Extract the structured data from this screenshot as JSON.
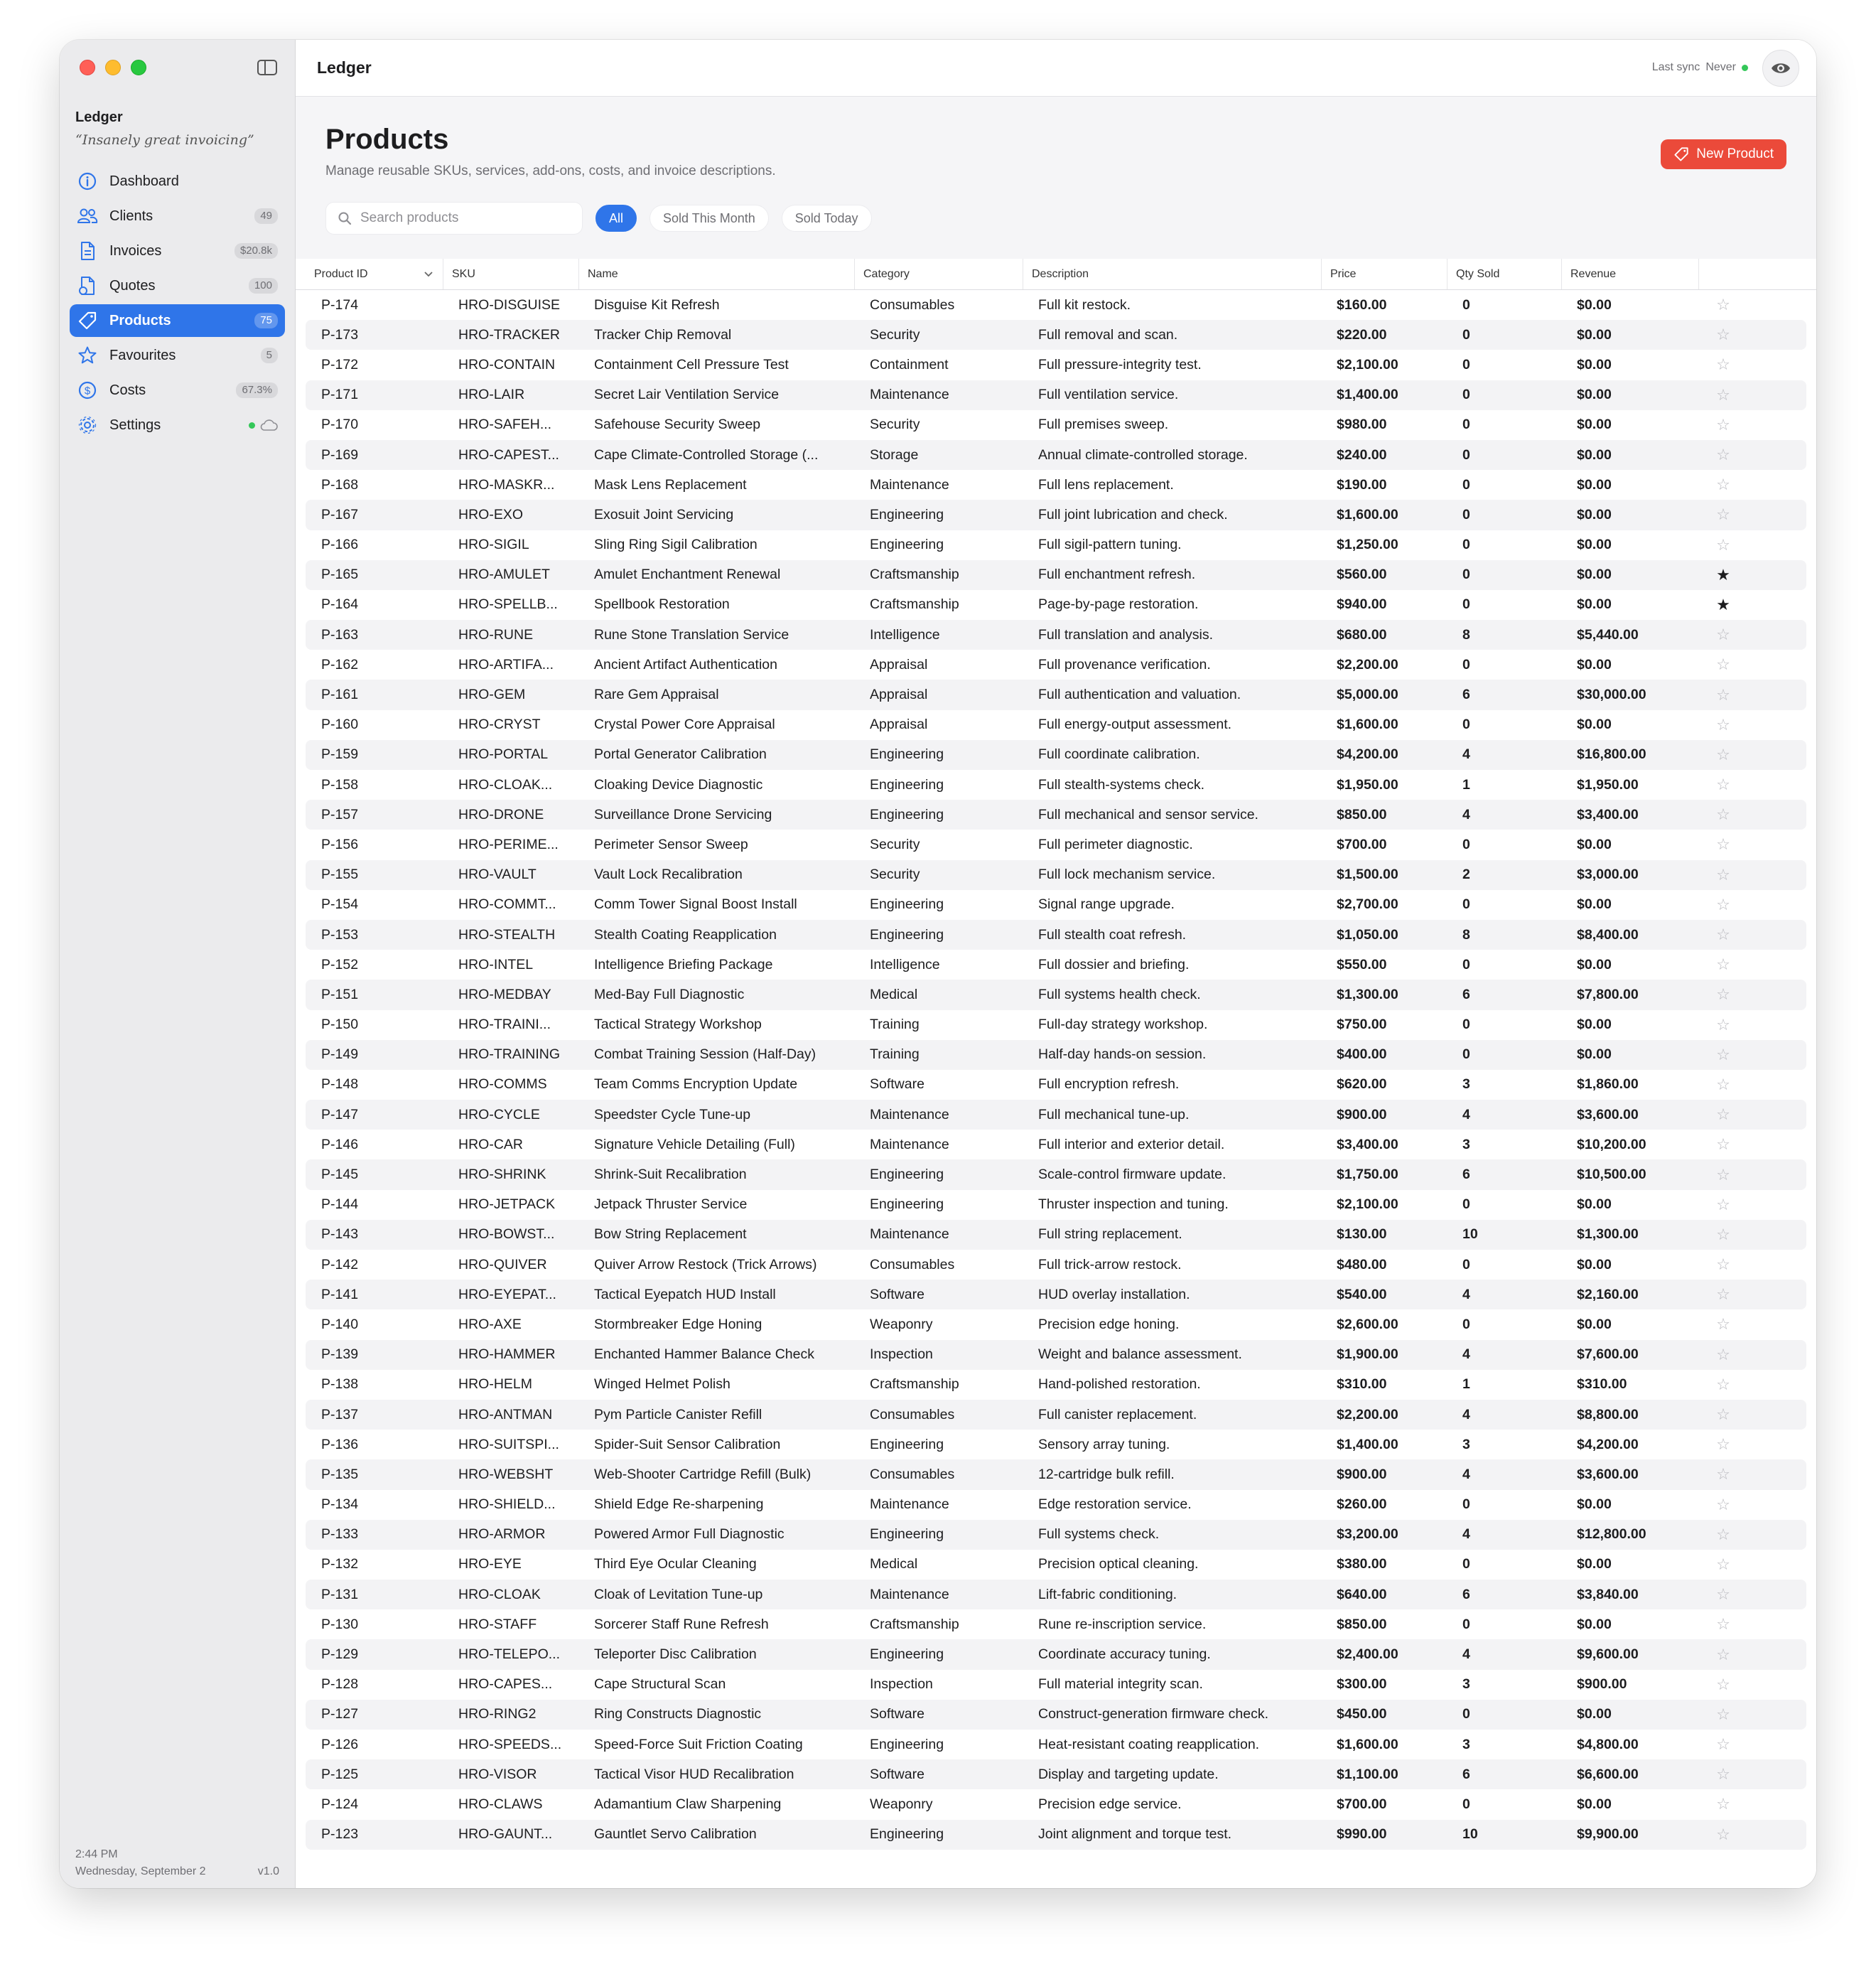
{
  "app": {
    "name": "Ledger",
    "tagline": "“Insanely great invoicing”",
    "footer_time": "2:44 PM",
    "footer_date": "Wednesday, September 2",
    "version": "v1.0",
    "accent": "#2f75e9"
  },
  "sidebar": {
    "items": [
      {
        "label": "Dashboard",
        "badge": "",
        "icon": "info-circle-icon"
      },
      {
        "label": "Clients",
        "badge": "49",
        "icon": "people-icon"
      },
      {
        "label": "Invoices",
        "badge": "$20.8k",
        "icon": "document-icon"
      },
      {
        "label": "Quotes",
        "badge": "100",
        "icon": "quote-document-icon"
      },
      {
        "label": "Products",
        "badge": "75",
        "icon": "tag-icon"
      },
      {
        "label": "Favourites",
        "badge": "5",
        "icon": "star-icon"
      },
      {
        "label": "Costs",
        "badge": "67.3%",
        "icon": "dollar-circle-icon"
      },
      {
        "label": "Settings",
        "badge": "",
        "icon": "gear-icon"
      }
    ]
  },
  "topbar": {
    "title": "Ledger",
    "sync_label": "Last sync",
    "sync_value": "Never"
  },
  "page": {
    "title": "Products",
    "subtitle": "Manage reusable SKUs, services, add-ons, costs, and invoice descriptions.",
    "new_button": "New Product",
    "new_button_color": "#eb4a3a",
    "search_placeholder": "Search products",
    "filters": [
      "All",
      "Sold This Month",
      "Sold Today"
    ]
  },
  "table": {
    "columns": [
      "Product ID",
      "SKU",
      "Name",
      "Category",
      "Description",
      "Price",
      "Qty Sold",
      "Revenue"
    ],
    "rows": [
      [
        "P-174",
        "HRO-DISGUISE",
        "Disguise Kit Refresh",
        "Consumables",
        "Full kit restock.",
        "$160.00",
        "0",
        "$0.00",
        false
      ],
      [
        "P-173",
        "HRO-TRACKER",
        "Tracker Chip Removal",
        "Security",
        "Full removal and scan.",
        "$220.00",
        "0",
        "$0.00",
        false
      ],
      [
        "P-172",
        "HRO-CONTAIN",
        "Containment Cell Pressure Test",
        "Containment",
        "Full pressure-integrity test.",
        "$2,100.00",
        "0",
        "$0.00",
        false
      ],
      [
        "P-171",
        "HRO-LAIR",
        "Secret Lair Ventilation Service",
        "Maintenance",
        "Full ventilation service.",
        "$1,400.00",
        "0",
        "$0.00",
        false
      ],
      [
        "P-170",
        "HRO-SAFEH...",
        "Safehouse Security Sweep",
        "Security",
        "Full premises sweep.",
        "$980.00",
        "0",
        "$0.00",
        false
      ],
      [
        "P-169",
        "HRO-CAPEST...",
        "Cape Climate-Controlled Storage (...",
        "Storage",
        "Annual climate-controlled storage.",
        "$240.00",
        "0",
        "$0.00",
        false
      ],
      [
        "P-168",
        "HRO-MASKR...",
        "Mask Lens Replacement",
        "Maintenance",
        "Full lens replacement.",
        "$190.00",
        "0",
        "$0.00",
        false
      ],
      [
        "P-167",
        "HRO-EXO",
        "Exosuit Joint Servicing",
        "Engineering",
        "Full joint lubrication and check.",
        "$1,600.00",
        "0",
        "$0.00",
        false
      ],
      [
        "P-166",
        "HRO-SIGIL",
        "Sling Ring Sigil Calibration",
        "Engineering",
        "Full sigil-pattern tuning.",
        "$1,250.00",
        "0",
        "$0.00",
        false
      ],
      [
        "P-165",
        "HRO-AMULET",
        "Amulet Enchantment Renewal",
        "Craftsmanship",
        "Full enchantment refresh.",
        "$560.00",
        "0",
        "$0.00",
        true
      ],
      [
        "P-164",
        "HRO-SPELLB...",
        "Spellbook Restoration",
        "Craftsmanship",
        "Page-by-page restoration.",
        "$940.00",
        "0",
        "$0.00",
        true
      ],
      [
        "P-163",
        "HRO-RUNE",
        "Rune Stone Translation Service",
        "Intelligence",
        "Full translation and analysis.",
        "$680.00",
        "8",
        "$5,440.00",
        false
      ],
      [
        "P-162",
        "HRO-ARTIFA...",
        "Ancient Artifact Authentication",
        "Appraisal",
        "Full provenance verification.",
        "$2,200.00",
        "0",
        "$0.00",
        false
      ],
      [
        "P-161",
        "HRO-GEM",
        "Rare Gem Appraisal",
        "Appraisal",
        "Full authentication and valuation.",
        "$5,000.00",
        "6",
        "$30,000.00",
        false
      ],
      [
        "P-160",
        "HRO-CRYST",
        "Crystal Power Core Appraisal",
        "Appraisal",
        "Full energy-output assessment.",
        "$1,600.00",
        "0",
        "$0.00",
        false
      ],
      [
        "P-159",
        "HRO-PORTAL",
        "Portal Generator Calibration",
        "Engineering",
        "Full coordinate calibration.",
        "$4,200.00",
        "4",
        "$16,800.00",
        false
      ],
      [
        "P-158",
        "HRO-CLOAK...",
        "Cloaking Device Diagnostic",
        "Engineering",
        "Full stealth-systems check.",
        "$1,950.00",
        "1",
        "$1,950.00",
        false
      ],
      [
        "P-157",
        "HRO-DRONE",
        "Surveillance Drone Servicing",
        "Engineering",
        "Full mechanical and sensor service.",
        "$850.00",
        "4",
        "$3,400.00",
        false
      ],
      [
        "P-156",
        "HRO-PERIME...",
        "Perimeter Sensor Sweep",
        "Security",
        "Full perimeter diagnostic.",
        "$700.00",
        "0",
        "$0.00",
        false
      ],
      [
        "P-155",
        "HRO-VAULT",
        "Vault Lock Recalibration",
        "Security",
        "Full lock mechanism service.",
        "$1,500.00",
        "2",
        "$3,000.00",
        false
      ],
      [
        "P-154",
        "HRO-COMMT...",
        "Comm Tower Signal Boost Install",
        "Engineering",
        "Signal range upgrade.",
        "$2,700.00",
        "0",
        "$0.00",
        false
      ],
      [
        "P-153",
        "HRO-STEALTH",
        "Stealth Coating Reapplication",
        "Engineering",
        "Full stealth coat refresh.",
        "$1,050.00",
        "8",
        "$8,400.00",
        false
      ],
      [
        "P-152",
        "HRO-INTEL",
        "Intelligence Briefing Package",
        "Intelligence",
        "Full dossier and briefing.",
        "$550.00",
        "0",
        "$0.00",
        false
      ],
      [
        "P-151",
        "HRO-MEDBAY",
        "Med-Bay Full Diagnostic",
        "Medical",
        "Full systems health check.",
        "$1,300.00",
        "6",
        "$7,800.00",
        false
      ],
      [
        "P-150",
        "HRO-TRAINI...",
        "Tactical Strategy Workshop",
        "Training",
        "Full-day strategy workshop.",
        "$750.00",
        "0",
        "$0.00",
        false
      ],
      [
        "P-149",
        "HRO-TRAINING",
        "Combat Training Session (Half-Day)",
        "Training",
        "Half-day hands-on session.",
        "$400.00",
        "0",
        "$0.00",
        false
      ],
      [
        "P-148",
        "HRO-COMMS",
        "Team Comms Encryption Update",
        "Software",
        "Full encryption refresh.",
        "$620.00",
        "3",
        "$1,860.00",
        false
      ],
      [
        "P-147",
        "HRO-CYCLE",
        "Speedster Cycle Tune-up",
        "Maintenance",
        "Full mechanical tune-up.",
        "$900.00",
        "4",
        "$3,600.00",
        false
      ],
      [
        "P-146",
        "HRO-CAR",
        "Signature Vehicle Detailing (Full)",
        "Maintenance",
        "Full interior and exterior detail.",
        "$3,400.00",
        "3",
        "$10,200.00",
        false
      ],
      [
        "P-145",
        "HRO-SHRINK",
        "Shrink-Suit Recalibration",
        "Engineering",
        "Scale-control firmware update.",
        "$1,750.00",
        "6",
        "$10,500.00",
        false
      ],
      [
        "P-144",
        "HRO-JETPACK",
        "Jetpack Thruster Service",
        "Engineering",
        "Thruster inspection and tuning.",
        "$2,100.00",
        "0",
        "$0.00",
        false
      ],
      [
        "P-143",
        "HRO-BOWST...",
        "Bow String Replacement",
        "Maintenance",
        "Full string replacement.",
        "$130.00",
        "10",
        "$1,300.00",
        false
      ],
      [
        "P-142",
        "HRO-QUIVER",
        "Quiver Arrow Restock (Trick Arrows)",
        "Consumables",
        "Full trick-arrow restock.",
        "$480.00",
        "0",
        "$0.00",
        false
      ],
      [
        "P-141",
        "HRO-EYEPAT...",
        "Tactical Eyepatch HUD Install",
        "Software",
        "HUD overlay installation.",
        "$540.00",
        "4",
        "$2,160.00",
        false
      ],
      [
        "P-140",
        "HRO-AXE",
        "Stormbreaker Edge Honing",
        "Weaponry",
        "Precision edge honing.",
        "$2,600.00",
        "0",
        "$0.00",
        false
      ],
      [
        "P-139",
        "HRO-HAMMER",
        "Enchanted Hammer Balance Check",
        "Inspection",
        "Weight and balance assessment.",
        "$1,900.00",
        "4",
        "$7,600.00",
        false
      ],
      [
        "P-138",
        "HRO-HELM",
        "Winged Helmet Polish",
        "Craftsmanship",
        "Hand-polished restoration.",
        "$310.00",
        "1",
        "$310.00",
        false
      ],
      [
        "P-137",
        "HRO-ANTMAN",
        "Pym Particle Canister Refill",
        "Consumables",
        "Full canister replacement.",
        "$2,200.00",
        "4",
        "$8,800.00",
        false
      ],
      [
        "P-136",
        "HRO-SUITSPI...",
        "Spider-Suit Sensor Calibration",
        "Engineering",
        "Sensory array tuning.",
        "$1,400.00",
        "3",
        "$4,200.00",
        false
      ],
      [
        "P-135",
        "HRO-WEBSHT",
        "Web-Shooter Cartridge Refill (Bulk)",
        "Consumables",
        "12-cartridge bulk refill.",
        "$900.00",
        "4",
        "$3,600.00",
        false
      ],
      [
        "P-134",
        "HRO-SHIELD...",
        "Shield Edge Re-sharpening",
        "Maintenance",
        "Edge restoration service.",
        "$260.00",
        "0",
        "$0.00",
        false
      ],
      [
        "P-133",
        "HRO-ARMOR",
        "Powered Armor Full Diagnostic",
        "Engineering",
        "Full systems check.",
        "$3,200.00",
        "4",
        "$12,800.00",
        false
      ],
      [
        "P-132",
        "HRO-EYE",
        "Third Eye Ocular Cleaning",
        "Medical",
        "Precision optical cleaning.",
        "$380.00",
        "0",
        "$0.00",
        false
      ],
      [
        "P-131",
        "HRO-CLOAK",
        "Cloak of Levitation Tune-up",
        "Maintenance",
        "Lift-fabric conditioning.",
        "$640.00",
        "6",
        "$3,840.00",
        false
      ],
      [
        "P-130",
        "HRO-STAFF",
        "Sorcerer Staff Rune Refresh",
        "Craftsmanship",
        "Rune re-inscription service.",
        "$850.00",
        "0",
        "$0.00",
        false
      ],
      [
        "P-129",
        "HRO-TELEPO...",
        "Teleporter Disc Calibration",
        "Engineering",
        "Coordinate accuracy tuning.",
        "$2,400.00",
        "4",
        "$9,600.00",
        false
      ],
      [
        "P-128",
        "HRO-CAPES...",
        "Cape Structural Scan",
        "Inspection",
        "Full material integrity scan.",
        "$300.00",
        "3",
        "$900.00",
        false
      ],
      [
        "P-127",
        "HRO-RING2",
        "Ring Constructs Diagnostic",
        "Software",
        "Construct-generation firmware check.",
        "$450.00",
        "0",
        "$0.00",
        false
      ],
      [
        "P-126",
        "HRO-SPEEDS...",
        "Speed-Force Suit Friction Coating",
        "Engineering",
        "Heat-resistant coating reapplication.",
        "$1,600.00",
        "3",
        "$4,800.00",
        false
      ],
      [
        "P-125",
        "HRO-VISOR",
        "Tactical Visor HUD Recalibration",
        "Software",
        "Display and targeting update.",
        "$1,100.00",
        "6",
        "$6,600.00",
        false
      ],
      [
        "P-124",
        "HRO-CLAWS",
        "Adamantium Claw Sharpening",
        "Weaponry",
        "Precision edge service.",
        "$700.00",
        "0",
        "$0.00",
        false
      ],
      [
        "P-123",
        "HRO-GAUNT...",
        "Gauntlet Servo Calibration",
        "Engineering",
        "Joint alignment and torque test.",
        "$990.00",
        "10",
        "$9,900.00",
        false
      ]
    ]
  }
}
